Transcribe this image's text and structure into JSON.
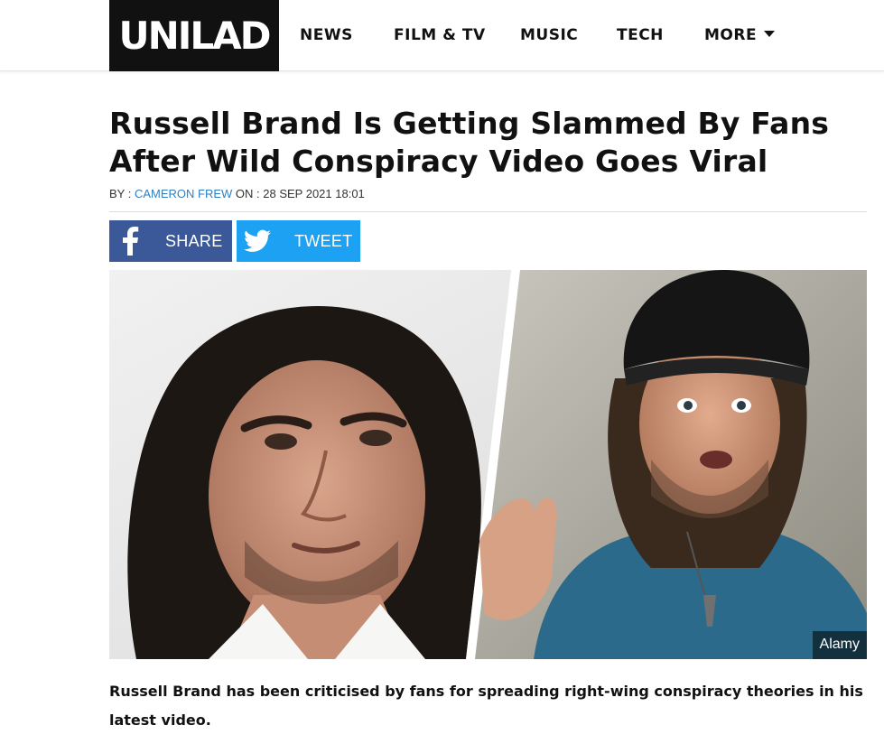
{
  "site": {
    "logo_text": "UNILAD",
    "nav": [
      {
        "label": "NEWS"
      },
      {
        "label": "FILM & TV"
      },
      {
        "label": "MUSIC"
      },
      {
        "label": "TECH"
      },
      {
        "label": "MORE"
      }
    ]
  },
  "article": {
    "headline": "Russell Brand Is Getting Slammed By Fans After Wild Conspiracy Video Goes Viral",
    "byline_prefix": "BY : ",
    "author": "CAMERON FREW",
    "date_prefix": " ON : ",
    "date": "28 SEP 2021 18:01",
    "share": {
      "facebook_label": "SHARE",
      "twitter_label": "TWEET"
    },
    "image_credit": "Alamy",
    "intro": "Russell Brand has been criticised by fans for spreading right-wing conspiracy theories in his latest video."
  },
  "colors": {
    "facebook": "#3b5998",
    "twitter": "#1da1f2",
    "author_link": "#2f7fc1",
    "logo_bg": "#111111"
  }
}
